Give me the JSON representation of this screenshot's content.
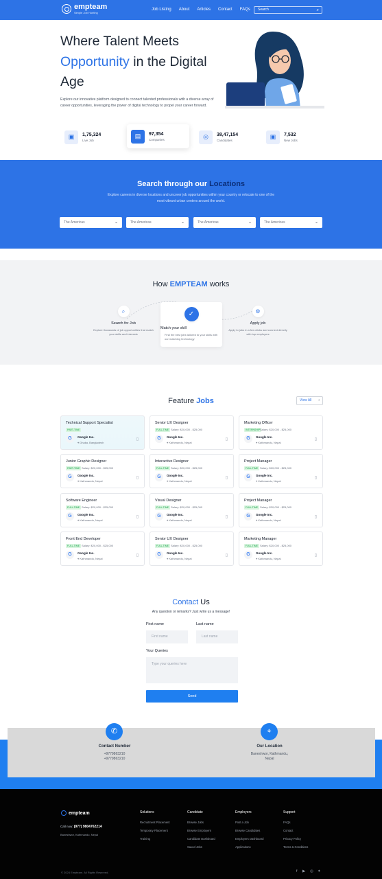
{
  "nav": {
    "brand": "empteam",
    "tagline": "Simple Job Hunting",
    "links": [
      "Job Listing",
      "About",
      "Articles",
      "Contact",
      "FAQs"
    ],
    "search_placeholder": "Search"
  },
  "hero": {
    "title_line1": "Where Talent Meets",
    "title_blue": "Opportunity",
    "title_rest": " in the Digital",
    "title_line3": "Age",
    "description": "Explore our innovative platform designed to connect talented professionals with a diverse array of career opportunities, leveraging the power of digital technology to propel your career forward."
  },
  "stats": [
    {
      "value": "1,75,324",
      "label": "Live Job",
      "icon": "briefcase-icon"
    },
    {
      "value": "97,354",
      "label": "Companies",
      "icon": "building-icon"
    },
    {
      "value": "38,47,154",
      "label": "Candidates",
      "icon": "users-icon"
    },
    {
      "value": "7,532",
      "label": "New Jobs",
      "icon": "briefcase-icon"
    }
  ],
  "locations": {
    "title": "Search through our ",
    "title_accent": "Locations",
    "description": "Explore careers in diverse locations and uncover job opportunities within your country or relocate to one of the most vibrant urban centers around the world.",
    "selects": [
      "The Americas",
      "The Americas",
      "The Americas",
      "The Americas"
    ]
  },
  "how": {
    "title_pre": "How ",
    "title_accent": "EMPTEAM",
    "title_post": " works",
    "steps": [
      {
        "title": "Search for Job",
        "desc": "Explore thousands of job opportunities that match your skills and interests"
      },
      {
        "title": "Match your skill",
        "desc": "Find the best jobs tailored to your skills with our matching technology"
      },
      {
        "title": "Apply job",
        "desc": "Apply to jobs in a few clicks and connect directly with top employers"
      }
    ]
  },
  "featured": {
    "title": "Feature ",
    "title_accent": "Jobs",
    "view_all": "View All",
    "jobs": [
      {
        "title": "Technical Support Specialist",
        "type": "PART-TIME",
        "salary": "",
        "company": "Google Inc.",
        "location": "Dhaka, Bangladesh"
      },
      {
        "title": "Senior UX Designer",
        "type": "FULL-TIME",
        "salary": "Salary: $20,000 - $25,000",
        "company": "Google Inc.",
        "location": "Kathmandu, Nepal"
      },
      {
        "title": "Marketing Officer",
        "type": "INTERNSHIP",
        "salary": "Salary: $20,000 - $25,000",
        "company": "Google Inc.",
        "location": "Kathmandu, Nepal"
      },
      {
        "title": "Junior Graphic Designer",
        "type": "PART-TIME",
        "salary": "Salary: $20,000 - $25,000",
        "company": "Google Inc.",
        "location": "Kathmandu, Nepal"
      },
      {
        "title": "Interactive Designer",
        "type": "FULL-TIME",
        "salary": "Salary: $20,000 - $25,000",
        "company": "Google Inc.",
        "location": "Kathmandu, Nepal"
      },
      {
        "title": "Project Manager",
        "type": "FULL-TIME",
        "salary": "Salary: $20,000 - $25,000",
        "company": "Google Inc.",
        "location": "Kathmandu, Nepal"
      },
      {
        "title": "Software Engineer",
        "type": "FULL-TIME",
        "salary": "Salary: $20,000 - $25,000",
        "company": "Google Inc.",
        "location": "Kathmandu, Nepal"
      },
      {
        "title": "Visual Designer",
        "type": "FULL-TIME",
        "salary": "Salary: $20,000 - $25,000",
        "company": "Google Inc.",
        "location": "Kathmandu, Nepal"
      },
      {
        "title": "Project Manager",
        "type": "FULL-TIME",
        "salary": "Salary: $20,000 - $25,000",
        "company": "Google Inc.",
        "location": "Kathmandu, Nepal"
      },
      {
        "title": "Front End Developer",
        "type": "FULL-TIME",
        "salary": "Salary: $20,000 - $25,000",
        "company": "Google Inc.",
        "location": "Kathmandu, Nepal"
      },
      {
        "title": "Senior UX Designer",
        "type": "FULL-TIME",
        "salary": "Salary: $20,000 - $25,000",
        "company": "Google Inc.",
        "location": "Kathmandu, Nepal"
      },
      {
        "title": "Marketing Manager",
        "type": "FULL-TIME",
        "salary": "Salary: $20,000 - $25,000",
        "company": "Google Inc.",
        "location": "Kathmandu, Nepal"
      }
    ]
  },
  "contact": {
    "title_accent": "Contact",
    "title_rest": " Us",
    "subtitle": "Any question or remarks? Just write us a message!",
    "first_name_label": "First name",
    "first_name_placeholder": "First name",
    "last_name_label": "Last name",
    "last_name_placeholder": "Last name",
    "queries_label": "Your Queries",
    "queries_placeholder": "Type your queries here",
    "send": "Send"
  },
  "info": {
    "number_title": "Contact Number",
    "numbers": [
      "+9779863210",
      "+9779863210"
    ],
    "location_title": "Our Location",
    "location_lines": [
      "Baneshwor, Kathmandu,",
      "Nepal"
    ]
  },
  "footer": {
    "brand": "empteam",
    "call_label": "Call now: ",
    "call_number": "(977) 9804762214",
    "address": "Baneshwor, Kathmandu, Nepal",
    "columns": [
      {
        "title": "Solutions",
        "links": [
          "Recruitment Placement",
          "Temporary Placement",
          "Training"
        ]
      },
      {
        "title": "Candidate",
        "links": [
          "Browse Jobs",
          "Browse Employers",
          "Candidate Dashboard",
          "Saved Jobs"
        ]
      },
      {
        "title": "Employers",
        "links": [
          "Post a Job",
          "Browse Candidates",
          "Employers Dashboard",
          "Applications"
        ]
      },
      {
        "title": "Support",
        "links": [
          "FAQs",
          "Contact",
          "Privacy Policy",
          "Terms & Conditions"
        ]
      }
    ],
    "copyright": "© 2024 Empteam. All Rights Reserved.",
    "social": [
      "facebook-icon",
      "youtube-icon",
      "instagram-icon",
      "twitter-icon"
    ]
  }
}
